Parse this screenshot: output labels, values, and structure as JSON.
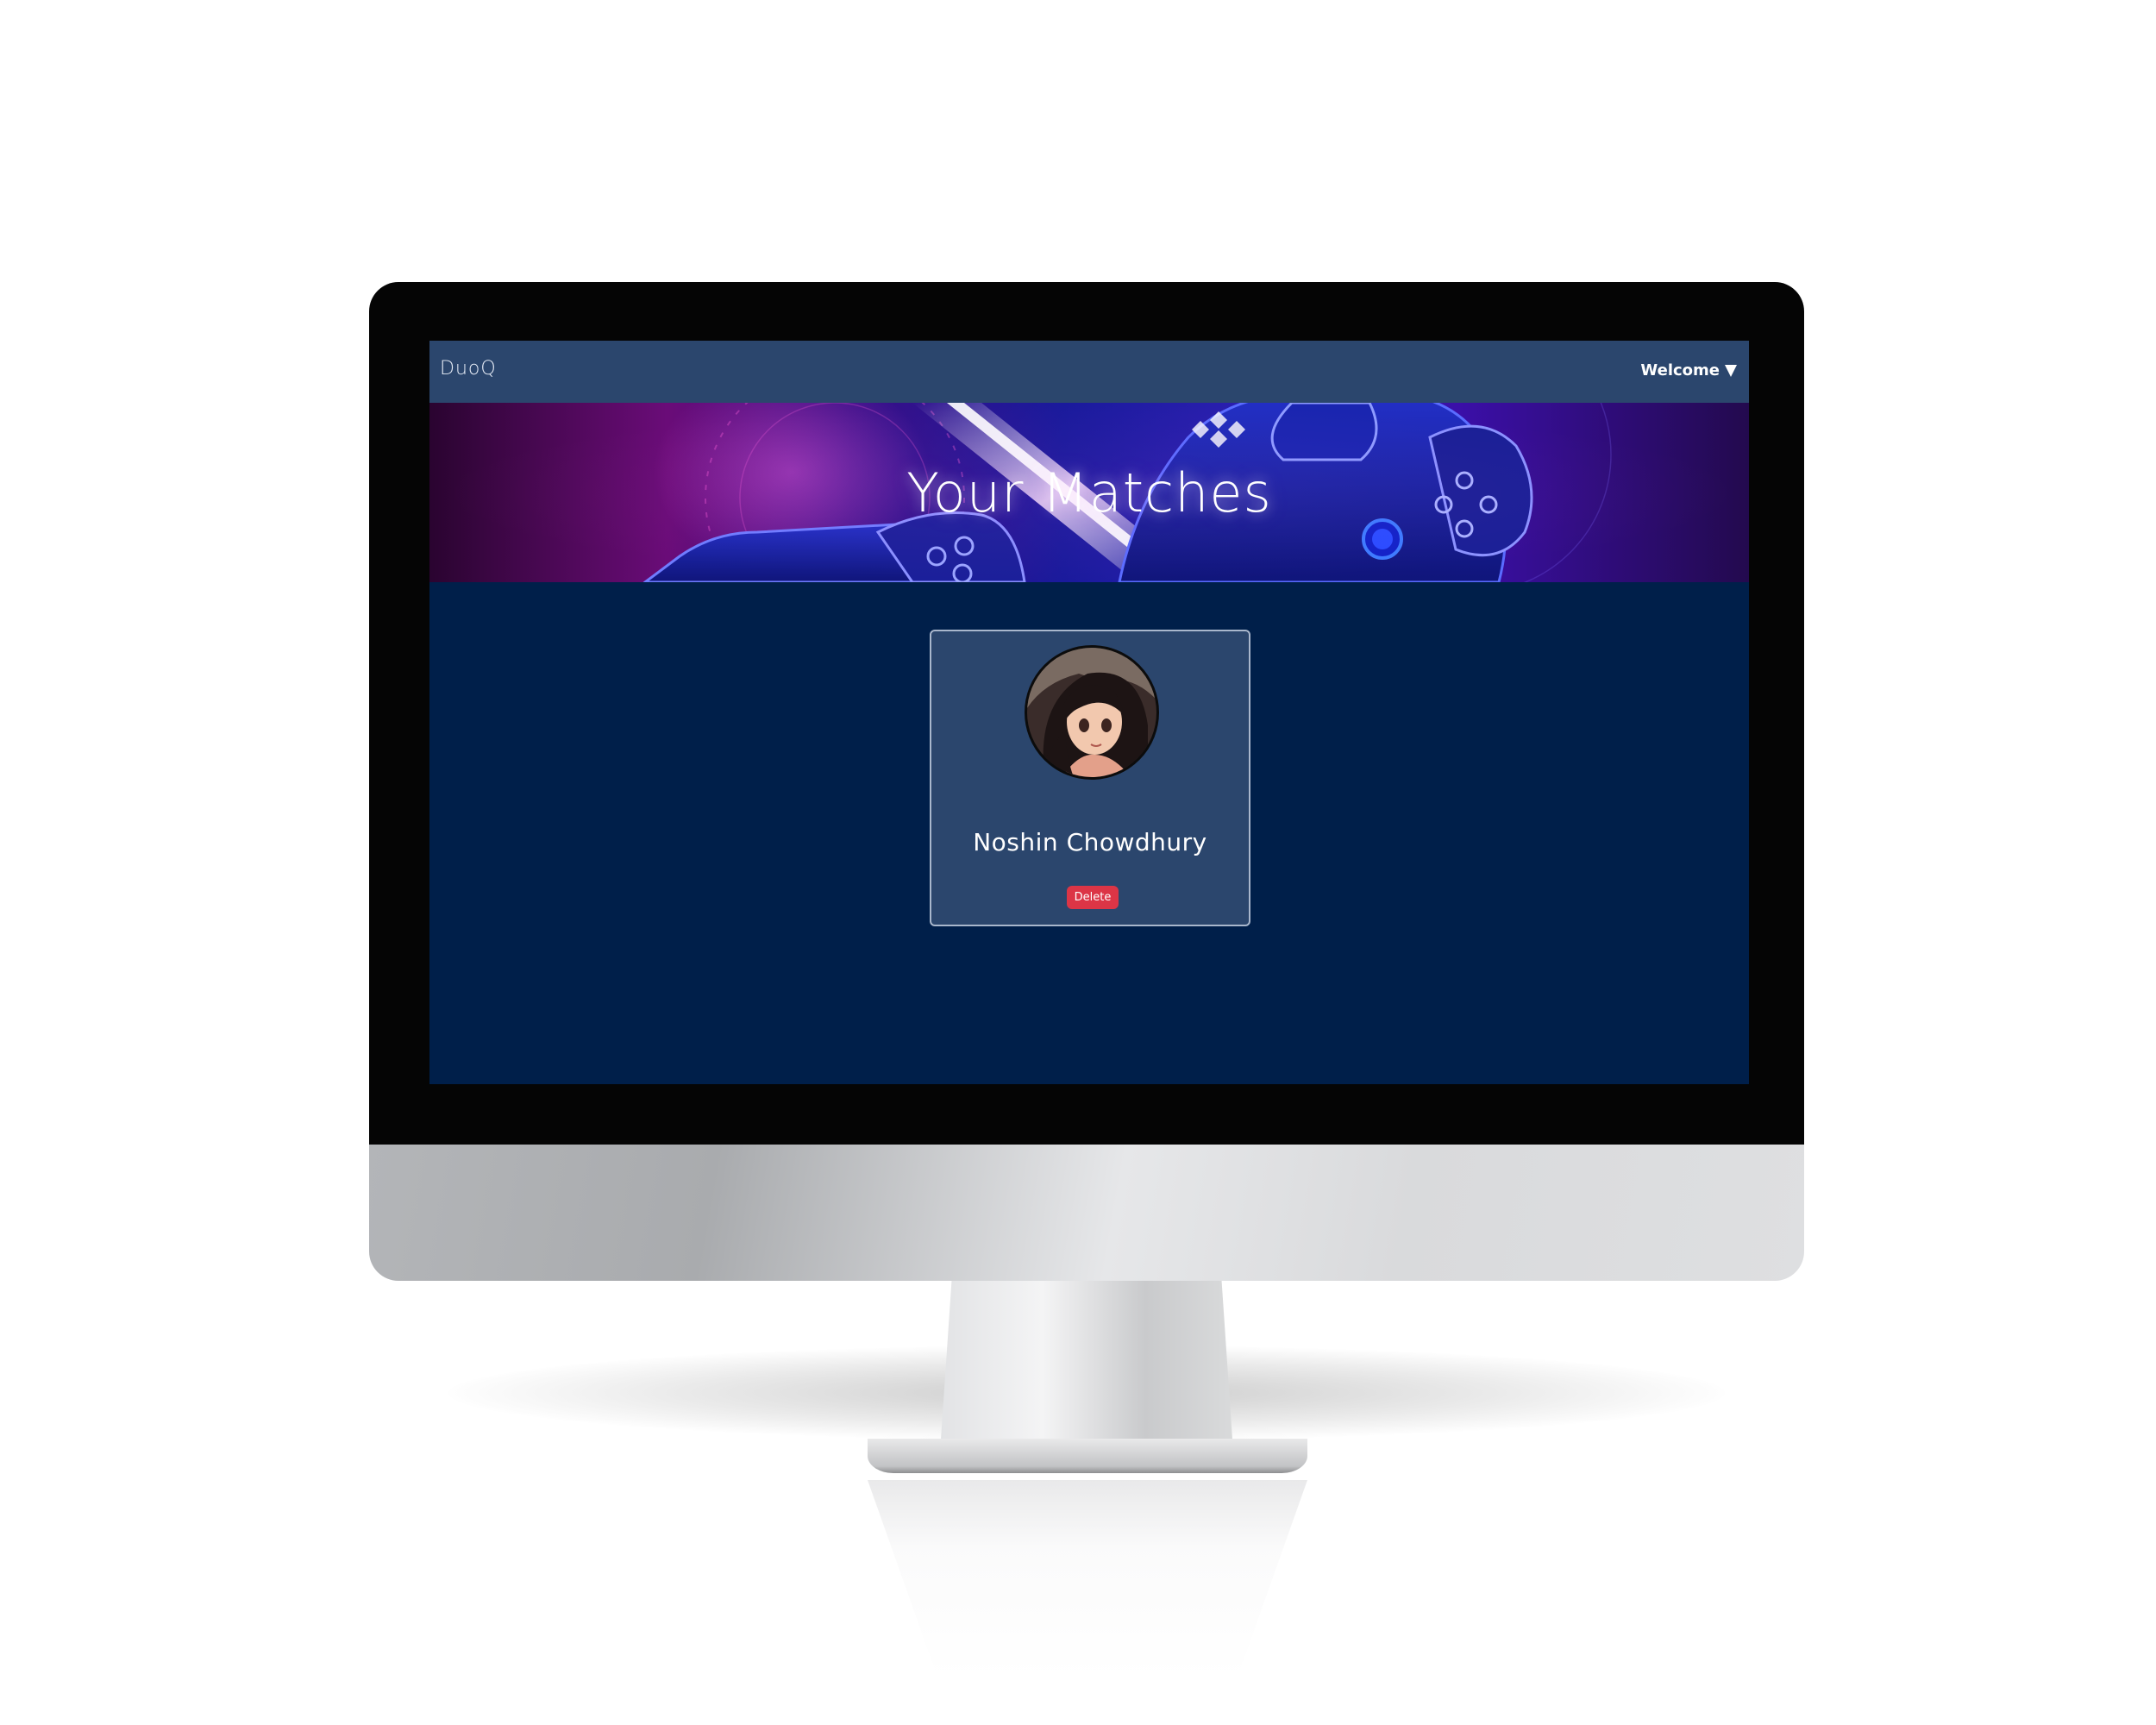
{
  "navbar": {
    "brand": "DuoQ",
    "user_menu_label": "Welcome",
    "user_menu_icon": "caret-down-icon"
  },
  "hero": {
    "title": "Your Matches"
  },
  "matches": [
    {
      "name": "Noshin Chowdhury",
      "delete_label": "Delete"
    }
  ],
  "colors": {
    "navbar": "#2b466d",
    "page_background": "#001f4a",
    "card_background": "#2b466d",
    "card_border": "#a9b7cc",
    "delete_button": "#dc3546"
  }
}
